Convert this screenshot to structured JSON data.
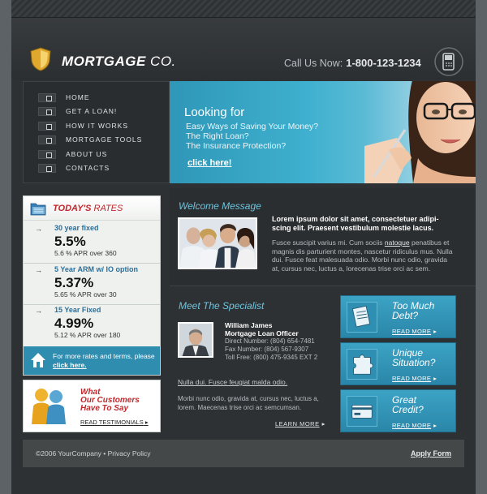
{
  "header": {
    "logo_bold": "MORTGAGE",
    "logo_rest": "CO.",
    "call_label": "Call Us Now:",
    "phone": "1-800-123-1234"
  },
  "nav": {
    "items": [
      {
        "label": "HOME"
      },
      {
        "label": "GET A LOAN!"
      },
      {
        "label": "HOW IT WORKS"
      },
      {
        "label": "MORTGAGE TOOLS"
      },
      {
        "label": "ABOUT US"
      },
      {
        "label": "CONTACTS"
      }
    ]
  },
  "banner": {
    "title": "Looking for",
    "lines": [
      "Easy Ways of Saving Your Money?",
      "The Right Loan?",
      "The Insurance Protection?"
    ],
    "link": "click here!"
  },
  "rates": {
    "title_a": "TODAY'S",
    "title_b": "RATES",
    "items": [
      {
        "name": "30 year fixed",
        "value": "5.5%",
        "apr": "5.6 % APR over 360"
      },
      {
        "name": "5 Year ARM w/ IO option",
        "value": "5.37%",
        "apr": "5.65 % APR over 30"
      },
      {
        "name": "15 Year Fixed",
        "value": "4.99%",
        "apr": "5.12 % APR over 180"
      }
    ],
    "footer_text": "For more rates and terms, please",
    "footer_link": "click here."
  },
  "customers": {
    "line1": "What",
    "line2": "Our Customers",
    "line3": "Have To Say",
    "link": "READ TESTIMONIALS"
  },
  "welcome": {
    "title": "Welcome Message",
    "lead": "Lorem ipsum dolor sit amet, consectetuer adipi-scing elit. Praesent vestibulum molestie lacus.",
    "body_a": "Fusce suscipit varius mi. Cum sociis",
    "body_link": "natoque",
    "body_b": "penatibus et magnis dis parturient montes, nascetur ridiculus mus. Nulla dui. Fusce feat malesuada odio. Morbi nunc odio, gravida at, cursus nec, luctus a, lorecenas trise orci ac sem."
  },
  "specialist": {
    "title": "Meet The Specialist",
    "name": "William James",
    "role": "Mortgage Loan Officer",
    "direct": "Direct Number: (804) 654-7481",
    "fax": "Fax Number: (804) 567-9307",
    "toll": "Toll Free: (800) 475-9345 EXT 2",
    "link": "Nulla dui. Fusce feugiat malda odio.",
    "body": "Morbi nunc odio, gravida at, cursus nec, luctus a, lorem. Maecenas trise orci ac semcumsan.",
    "more": "LEARN MORE"
  },
  "promos": [
    {
      "line1": "Too Much",
      "line2": "Debt?",
      "more": "READ MORE",
      "icon": "document-icon"
    },
    {
      "line1": "Unique",
      "line2": "Situation?",
      "more": "READ MORE",
      "icon": "puzzle-icon"
    },
    {
      "line1": "Great",
      "line2": "Credit?",
      "more": "READ MORE",
      "icon": "credit-card-icon"
    }
  ],
  "footer": {
    "copyright": "©2006 YourCompany • Privacy Policy",
    "apply": "Apply Form"
  },
  "colors": {
    "accent": "#3fb0cf",
    "red": "#c0282d",
    "dark": "#2e3133"
  }
}
